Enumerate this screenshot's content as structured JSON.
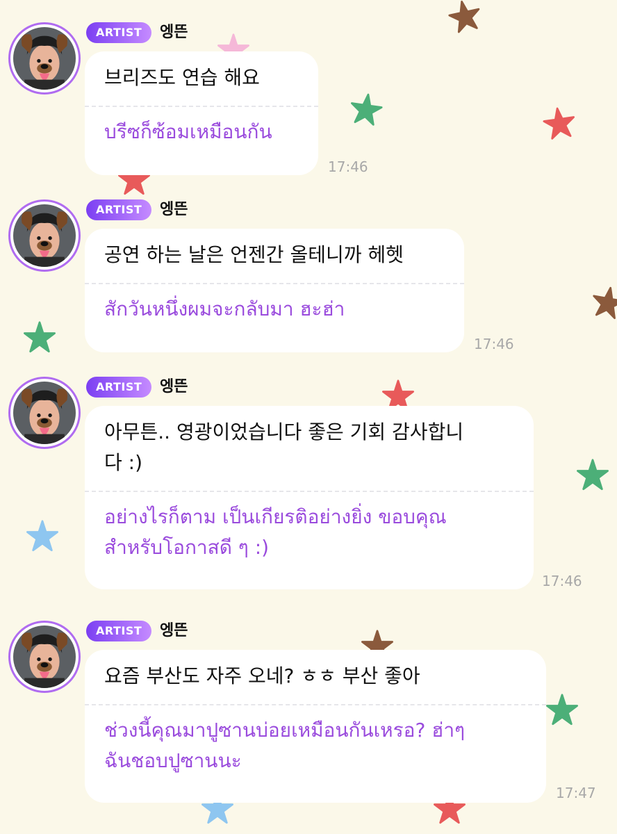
{
  "colors": {
    "background": "#fbf8e9",
    "badge_gradient_start": "#7b3ff2",
    "badge_gradient_end": "#c58bff",
    "translation_text": "#9a4bdd",
    "avatar_ring": "#b06cf0",
    "timestamp": "#a8a8a8"
  },
  "background_stars": [
    {
      "color": "#8b5a3c"
    },
    {
      "color": "#f5b8d8"
    },
    {
      "color": "#4caf78"
    },
    {
      "color": "#e85a5a"
    },
    {
      "color": "#e85a5a"
    },
    {
      "color": "#8b5a3c"
    },
    {
      "color": "#4caf78"
    },
    {
      "color": "#e85a5a"
    },
    {
      "color": "#4caf78"
    },
    {
      "color": "#8ec6f0"
    },
    {
      "color": "#8b5a3c"
    },
    {
      "color": "#4caf78"
    },
    {
      "color": "#8ec6f0"
    },
    {
      "color": "#e85a5a"
    }
  ],
  "messages": [
    {
      "badge": "ARTIST",
      "sender": "엥뜬",
      "original": [
        "브리즈도 연습 해요"
      ],
      "translation": [
        "บรีซก็ซ้อมเหมือนกัน"
      ],
      "time": "17:46",
      "avatar_icon": "artist-avatar-dog-filter"
    },
    {
      "badge": "ARTIST",
      "sender": "엥뜬",
      "original": [
        "공연 하는 날은 언젠간 올테니까 헤헷"
      ],
      "translation": [
        "สักวันหนึ่งผมจะกลับมา ฮะฮ่า"
      ],
      "time": "17:46",
      "avatar_icon": "artist-avatar-dog-filter"
    },
    {
      "badge": "ARTIST",
      "sender": "엥뜬",
      "original": [
        "아무튼.. 영광이었습니다 좋은 기회 감사합니",
        "다 :)"
      ],
      "translation": [
        "อย่างไรก็ตาม เป็นเกียรติอย่างยิ่ง ขอบคุณ",
        "สำหรับโอกาสดี ๆ :)"
      ],
      "time": "17:46",
      "avatar_icon": "artist-avatar-dog-filter"
    },
    {
      "badge": "ARTIST",
      "sender": "엥뜬",
      "original": [
        "요즘 부산도 자주 오네? ㅎㅎ 부산 좋아"
      ],
      "translation": [
        "ช่วงนี้คุณมาปูซานบ่อยเหมือนกันเหรอ? ฮ่าๆ",
        "ฉันชอบปูซานนะ"
      ],
      "time": "17:47",
      "avatar_icon": "artist-avatar-dog-filter"
    }
  ]
}
